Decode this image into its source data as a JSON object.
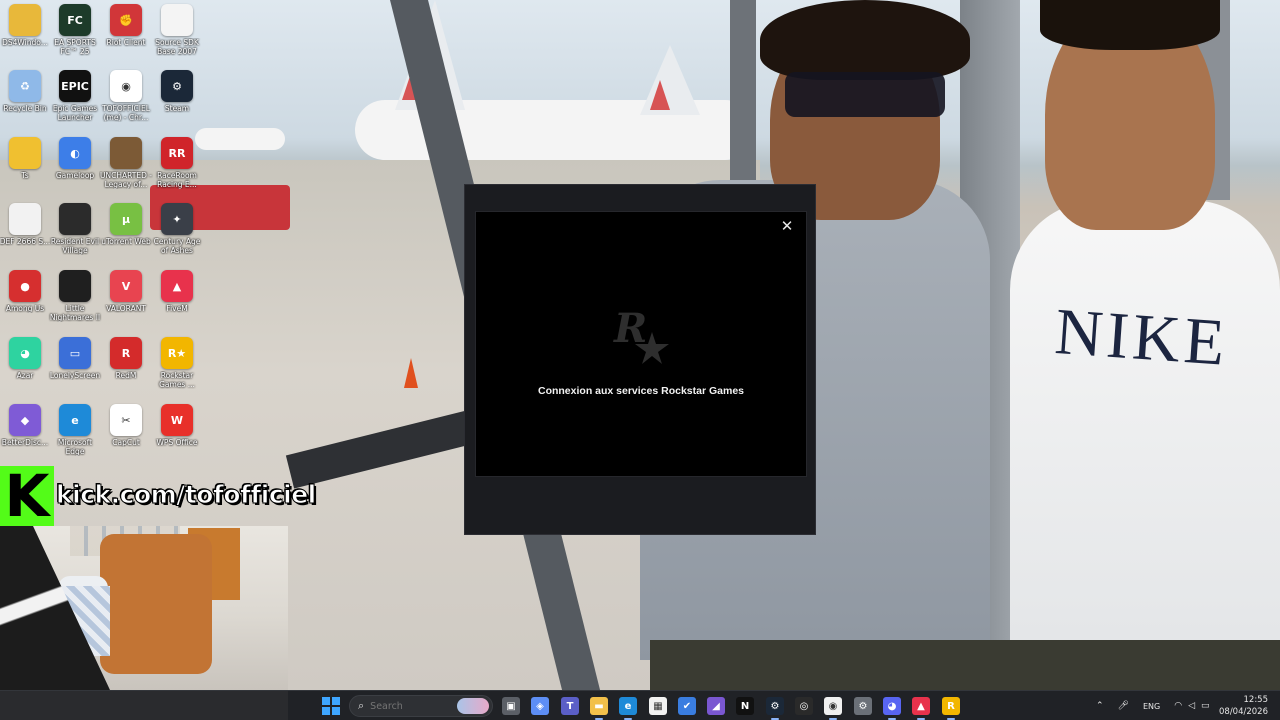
{
  "desktop": {
    "icons": [
      {
        "label": "DS4Windo...",
        "color": "#e8b83a",
        "glyph": ""
      },
      {
        "label": "EA SPORTS FC™ 25",
        "color": "#1d3b2a",
        "glyph": "FC"
      },
      {
        "label": "Riot Client",
        "color": "#d13639",
        "glyph": "✊"
      },
      {
        "label": "Source SDK Base 2007",
        "color": "#f4f4f4",
        "glyph": ""
      },
      {
        "label": "Recycle Bin",
        "color": "#8fb9e8",
        "glyph": "♻"
      },
      {
        "label": "Epic Games Launcher",
        "color": "#111111",
        "glyph": "EPIC"
      },
      {
        "label": "TOFOFFICIEL (me) - Chr...",
        "color": "#ffffff",
        "glyph": "◉"
      },
      {
        "label": "Steam",
        "color": "#1b2838",
        "glyph": "⚙"
      },
      {
        "label": "Ts",
        "color": "#f0c030",
        "glyph": ""
      },
      {
        "label": "Gameloop",
        "color": "#3d7ee8",
        "glyph": "◐"
      },
      {
        "label": "UNCHARTED - Legacy of...",
        "color": "#7c5a36",
        "glyph": ""
      },
      {
        "label": "RaceRoom Racing E...",
        "color": "#d0242a",
        "glyph": "RR"
      },
      {
        "label": "DEF 2666 S...",
        "color": "#f2f2f2",
        "glyph": ""
      },
      {
        "label": "Resident Evil Village",
        "color": "#2b2b2b",
        "glyph": ""
      },
      {
        "label": "uTorrent Web",
        "color": "#78c043",
        "glyph": "µ"
      },
      {
        "label": "Century Age of Ashes",
        "color": "#3a3f48",
        "glyph": "✦"
      },
      {
        "label": "Among Us",
        "color": "#d62f2f",
        "glyph": "●"
      },
      {
        "label": "Little Nightmares II",
        "color": "#1f1f1f",
        "glyph": ""
      },
      {
        "label": "VALORANT",
        "color": "#e84450",
        "glyph": "V"
      },
      {
        "label": "FiveM",
        "color": "#e8324c",
        "glyph": "▲"
      },
      {
        "label": "Azar",
        "color": "#2ed3a0",
        "glyph": "◕"
      },
      {
        "label": "LonelyScreen",
        "color": "#3b6fd8",
        "glyph": "▭"
      },
      {
        "label": "RedM",
        "color": "#d42b2b",
        "glyph": "R"
      },
      {
        "label": "Rockstar Games ...",
        "color": "#f2b600",
        "glyph": "R★"
      },
      {
        "label": "BetterDisc...",
        "color": "#7f5bd6",
        "glyph": "◆"
      },
      {
        "label": "Microsoft Edge",
        "color": "#1e8ad8",
        "glyph": "e"
      },
      {
        "label": "CapCut",
        "color": "#ffffff",
        "glyph": "✂"
      },
      {
        "label": "WPS Office",
        "color": "#e8302a",
        "glyph": "W"
      }
    ]
  },
  "stream_overlay": {
    "url_text": "kick.com/tofofficiel",
    "brand_letter": "K",
    "brand_color": "#53fc18"
  },
  "dialog": {
    "status": "Connexion aux services Rockstar Games",
    "close_symbol": "✕"
  },
  "taskbar": {
    "search_placeholder": "Search",
    "apps": [
      {
        "name": "task-view",
        "color": "#5b5f66",
        "glyph": "▣"
      },
      {
        "name": "copilot",
        "color": "#5d8ef5",
        "glyph": "◈"
      },
      {
        "name": "teams",
        "color": "#5b5fc7",
        "glyph": "T"
      },
      {
        "name": "file-explorer",
        "color": "#f2c04a",
        "glyph": "▬"
      },
      {
        "name": "edge",
        "color": "#1e8ad8",
        "glyph": "e"
      },
      {
        "name": "store",
        "color": "#f2f2f2",
        "glyph": "▦"
      },
      {
        "name": "todo",
        "color": "#3a7de0",
        "glyph": "✔"
      },
      {
        "name": "visual-studio",
        "color": "#7a57d1",
        "glyph": "◢"
      },
      {
        "name": "netflix",
        "color": "#111111",
        "glyph": "N"
      },
      {
        "name": "steam",
        "color": "#1b2838",
        "glyph": "⚙"
      },
      {
        "name": "spotify-or-obs",
        "color": "#2a2a2a",
        "glyph": "◎"
      },
      {
        "name": "chrome",
        "color": "#f0f0f0",
        "glyph": "◉"
      },
      {
        "name": "settings",
        "color": "#6b7078",
        "glyph": "⚙"
      },
      {
        "name": "discord",
        "color": "#5865f2",
        "glyph": "◕"
      },
      {
        "name": "fivem",
        "color": "#e8324c",
        "glyph": "▲"
      },
      {
        "name": "rockstar",
        "color": "#f2b600",
        "glyph": "R"
      }
    ],
    "tray": {
      "language": "ENG",
      "time": "12:55",
      "date": "08/04/2026"
    }
  }
}
